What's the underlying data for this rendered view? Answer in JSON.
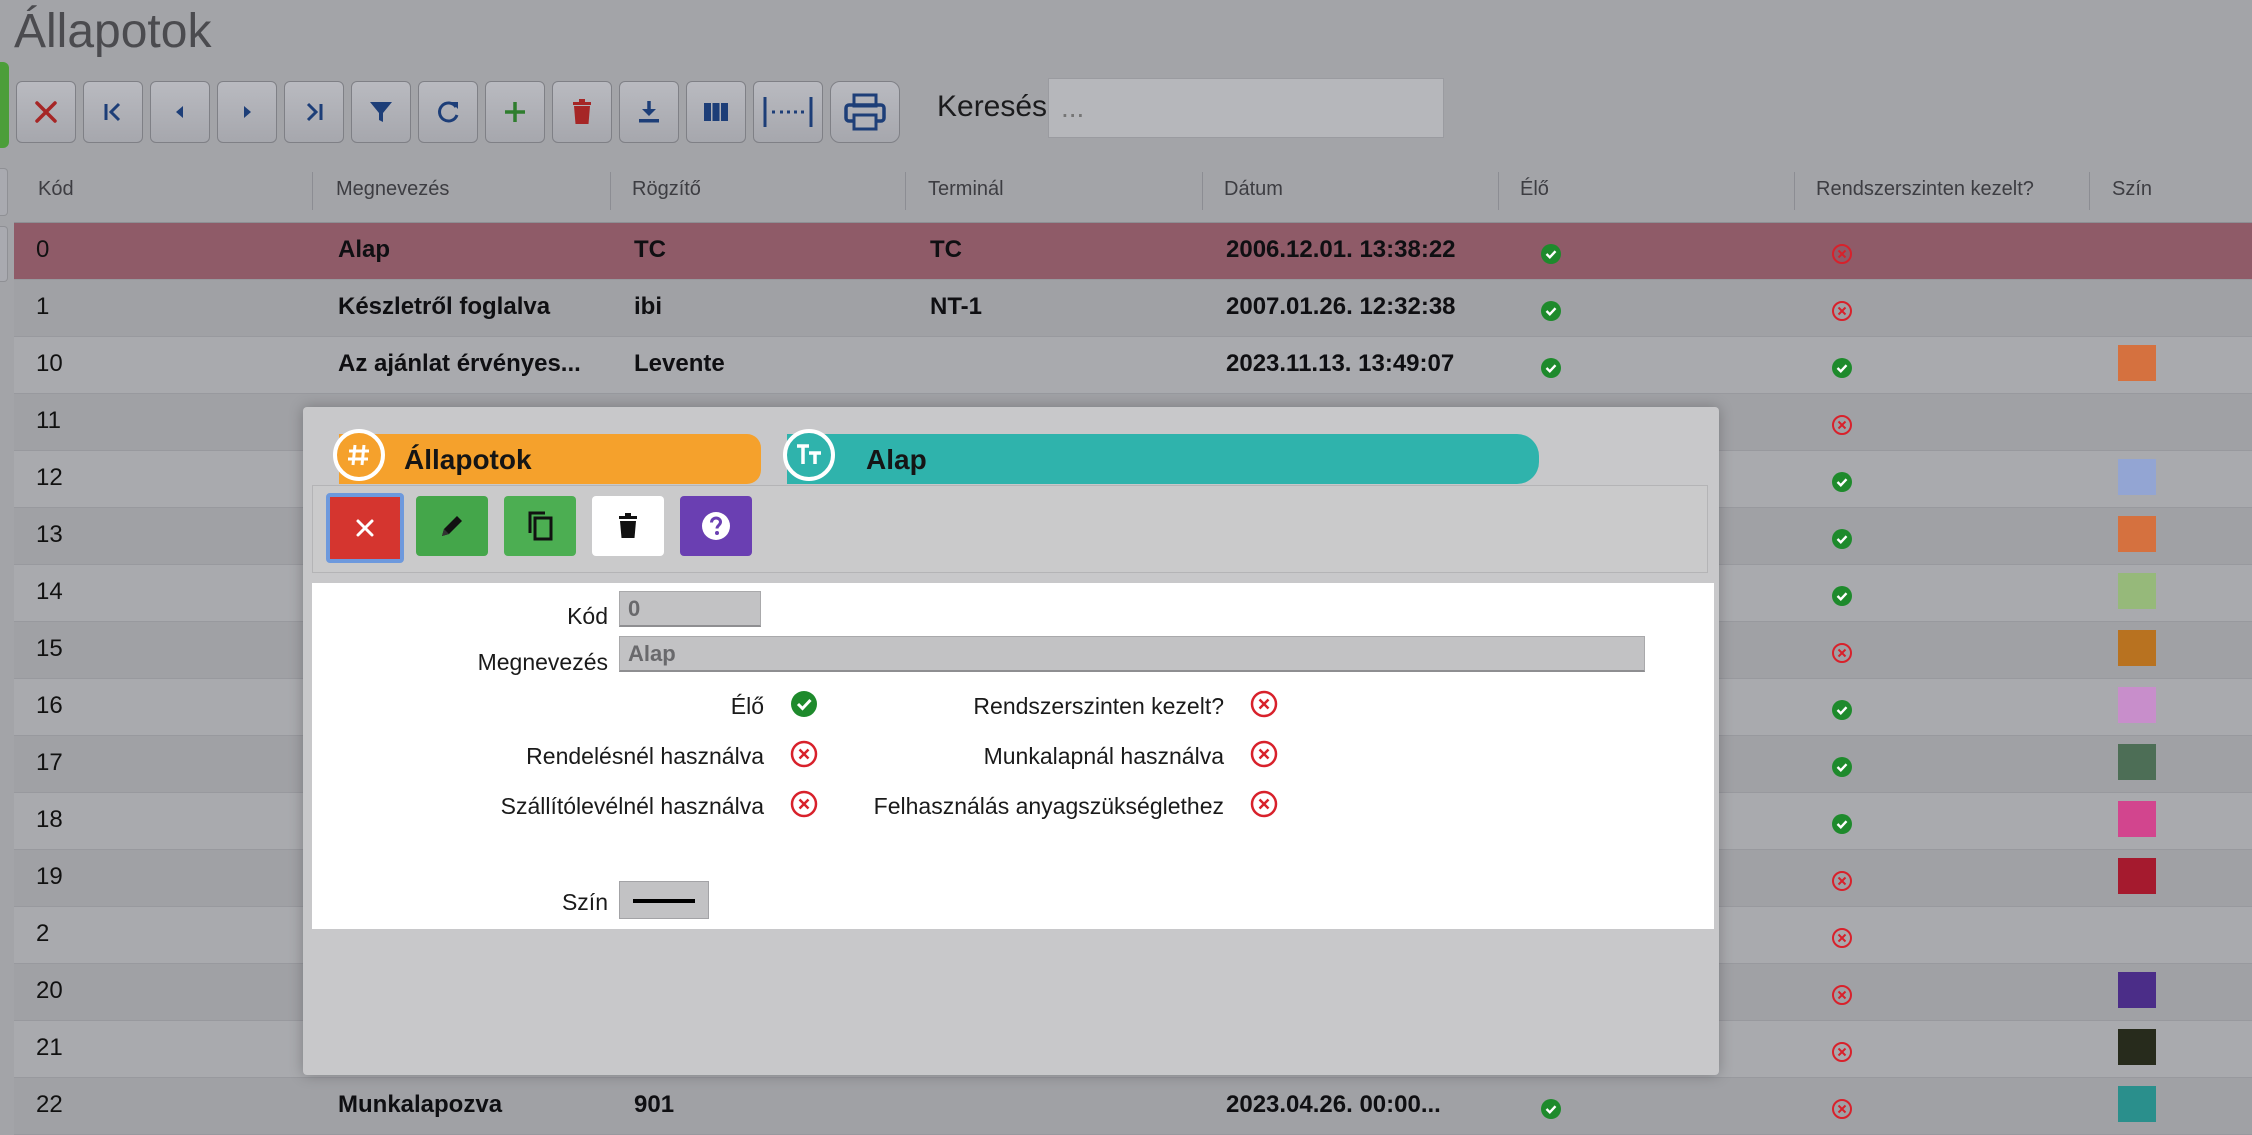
{
  "page": {
    "title": "Állapotok"
  },
  "toolbar": {
    "buttons": [
      {
        "icon": "close-icon"
      },
      {
        "icon": "first-page-icon"
      },
      {
        "icon": "prev-icon"
      },
      {
        "icon": "next-icon"
      },
      {
        "icon": "last-page-icon"
      },
      {
        "icon": "filter-icon"
      },
      {
        "icon": "refresh-icon"
      },
      {
        "icon": "plus-icon"
      },
      {
        "icon": "trash-icon"
      },
      {
        "icon": "download-icon"
      },
      {
        "icon": "columns-icon"
      },
      {
        "icon": "fit-width-icon"
      },
      {
        "icon": "print-icon"
      }
    ],
    "search_label": "Keresés:",
    "search_placeholder": "..."
  },
  "table": {
    "columns": [
      "Kód",
      "Megnevezés",
      "Rögzítő",
      "Terminál",
      "Dátum",
      "Élő",
      "Rendszerszinten kezelt?",
      "Szín"
    ],
    "rows": [
      {
        "kod": "0",
        "nev": "Alap",
        "rogzito": "TC",
        "terminal": "TC",
        "datum": "2006.12.01. 13:38:22",
        "elo": true,
        "rendszer": false,
        "szin": ""
      },
      {
        "kod": "1",
        "nev": "Készletről foglalva",
        "rogzito": "ibi",
        "terminal": "NT-1",
        "datum": "2007.01.26. 12:32:38",
        "elo": true,
        "rendszer": false,
        "szin": ""
      },
      {
        "kod": "10",
        "nev": "Az ajánlat érvényes...",
        "rogzito": "Levente",
        "terminal": "",
        "datum": "2023.11.13. 13:49:07",
        "elo": true,
        "rendszer": true,
        "szin": "#d5713f"
      },
      {
        "kod": "11",
        "nev": "",
        "rogzito": "",
        "terminal": "",
        "datum": "",
        "elo": null,
        "rendszer": false,
        "szin": ""
      },
      {
        "kod": "12",
        "nev": "",
        "rogzito": "",
        "terminal": "",
        "datum": "",
        "elo": null,
        "rendszer": true,
        "szin": "#93a5d3"
      },
      {
        "kod": "13",
        "nev": "",
        "rogzito": "",
        "terminal": "",
        "datum": "",
        "elo": null,
        "rendszer": true,
        "szin": "#d5713f"
      },
      {
        "kod": "14",
        "nev": "",
        "rogzito": "",
        "terminal": "",
        "datum": "",
        "elo": null,
        "rendszer": true,
        "szin": "#96b97a"
      },
      {
        "kod": "15",
        "nev": "",
        "rogzito": "",
        "terminal": "",
        "datum": "",
        "elo": null,
        "rendszer": false,
        "szin": "#b87220"
      },
      {
        "kod": "16",
        "nev": "",
        "rogzito": "",
        "terminal": "",
        "datum": "",
        "elo": null,
        "rendszer": true,
        "szin": "#c88ecb"
      },
      {
        "kod": "17",
        "nev": "",
        "rogzito": "",
        "terminal": "",
        "datum": "",
        "elo": null,
        "rendszer": true,
        "szin": "#4d6e56"
      },
      {
        "kod": "18",
        "nev": "",
        "rogzito": "",
        "terminal": "",
        "datum": "",
        "elo": null,
        "rendszer": true,
        "szin": "#d2458e"
      },
      {
        "kod": "19",
        "nev": "",
        "rogzito": "",
        "terminal": "",
        "datum": "",
        "elo": null,
        "rendszer": false,
        "szin": "#a51a2e"
      },
      {
        "kod": "2",
        "nev": "",
        "rogzito": "",
        "terminal": "",
        "datum": "",
        "elo": null,
        "rendszer": false,
        "szin": ""
      },
      {
        "kod": "20",
        "nev": "",
        "rogzito": "",
        "terminal": "",
        "datum": "",
        "elo": null,
        "rendszer": false,
        "szin": "#4b2d88"
      },
      {
        "kod": "21",
        "nev": "",
        "rogzito": "",
        "terminal": "",
        "datum": "",
        "elo": null,
        "rendszer": false,
        "szin": "#272b1c"
      },
      {
        "kod": "22",
        "nev": "Munkalapozva",
        "rogzito": "901",
        "terminal": "",
        "datum": "2023.04.26. 00:00...",
        "elo": true,
        "rendszer": false,
        "szin": "#2a8f8c"
      }
    ]
  },
  "modal": {
    "entity_title": "Állapotok",
    "record_title": "Alap",
    "buttons": [
      "close-icon",
      "pencil-icon",
      "copy-icon",
      "trash-icon",
      "help-icon"
    ],
    "fields": {
      "kod_label": "Kód",
      "kod_value": "0",
      "nev_label": "Megnevezés",
      "nev_value": "Alap",
      "elo_label": "Élő",
      "elo_value": true,
      "rendszer_label": "Rendszerszinten kezelt?",
      "rendszer_value": false,
      "rendeles_label": "Rendelésnél használva",
      "rendeles_value": false,
      "munkalap_label": "Munkalapnál használva",
      "munkalap_value": false,
      "szallito_label": "Szállítólevélnél használva",
      "szallito_value": false,
      "felhasznalas_label": "Felhasználás anyagszükséglethez",
      "felhasznalas_value": false,
      "szin_label": "Szín"
    }
  },
  "colors": {
    "check": "#1e8a2c",
    "cross": "#d8212b",
    "selected_row": "#8f5b68",
    "accent_orange": "#f5a12c",
    "accent_teal": "#2fb3ac"
  }
}
